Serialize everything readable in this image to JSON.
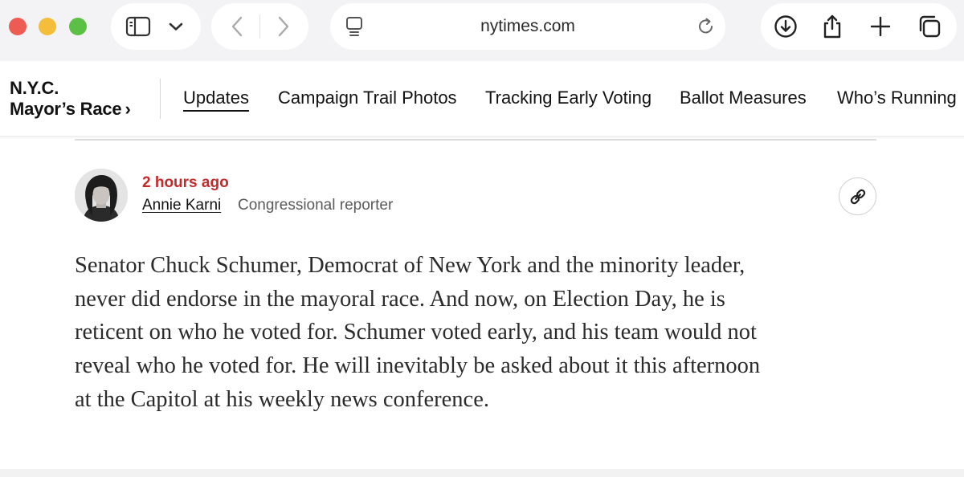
{
  "browser": {
    "url": "nytimes.com",
    "icons": {
      "sidebar": "sidebar-icon",
      "tab_menu": "chevron-down-icon",
      "back": "back-icon",
      "forward": "forward-icon",
      "page_menu": "page-menu-icon",
      "reload": "reload-icon",
      "download": "download-icon",
      "share": "share-icon",
      "new_tab": "plus-icon",
      "tabs": "tabs-overview-icon"
    }
  },
  "section": {
    "title_line1": "N.Y.C.",
    "title_line2": "Mayor’s Race",
    "chevron": "›"
  },
  "nav": {
    "items": [
      {
        "label": "Updates",
        "active": true
      },
      {
        "label": "Campaign Trail Photos",
        "active": false
      },
      {
        "label": "Tracking Early Voting",
        "active": false
      },
      {
        "label": "Ballot Measures",
        "active": false
      },
      {
        "label": "Who’s Running",
        "active": false
      }
    ]
  },
  "post": {
    "timestamp": "2 hours ago",
    "author": "Annie Karni",
    "author_role": "Congressional reporter",
    "link_icon": "link-icon",
    "body_lines": [
      "Senator Chuck Schumer, Democrat of New York and the minority leader,",
      "never did endorse in the mayoral race. And now, on Election Day, he is",
      "reticent on who he voted for. Schumer voted early, and his team would not",
      "reveal who he voted for. He will inevitably be asked about it this afternoon",
      "at the Capitol at his weekly news conference."
    ]
  },
  "colors": {
    "timestamp": "#c32b2b",
    "chrome_bg": "#f3f3f5",
    "close": "#ee5b52",
    "minimize": "#f4bd3a",
    "zoom": "#5dc046"
  }
}
